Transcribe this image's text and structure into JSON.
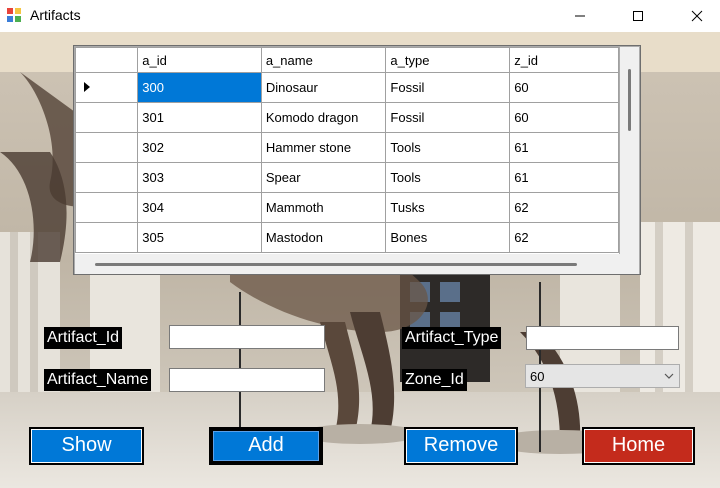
{
  "window": {
    "title": "Artifacts"
  },
  "grid": {
    "columns": [
      "a_id",
      "a_name",
      "a_type",
      "z_id"
    ],
    "rows": [
      [
        "300",
        "Dinosaur",
        "Fossil",
        "60"
      ],
      [
        "301",
        "Komodo dragon",
        "Fossil",
        "60"
      ],
      [
        "302",
        "Hammer stone",
        "Tools",
        "61"
      ],
      [
        "303",
        "Spear",
        "Tools",
        "61"
      ],
      [
        "304",
        "Mammoth",
        "Tusks",
        "62"
      ],
      [
        "305",
        "Mastodon",
        "Bones",
        "62"
      ]
    ],
    "current_row_marker_icon": "triangle-right-icon"
  },
  "form": {
    "artifact_id_label": "Artifact_Id",
    "artifact_id_value": "",
    "artifact_name_label": "Artifact_Name",
    "artifact_name_value": "",
    "artifact_type_label": "Artifact_Type",
    "artifact_type_value": "",
    "zone_id_label": "Zone_Id",
    "zone_id_value": "60"
  },
  "buttons": {
    "show": "Show",
    "add": "Add",
    "remove": "Remove",
    "home": "Home"
  },
  "colors": {
    "selection": "#0078d7",
    "button_blue": "#0078d7",
    "button_red": "#c42b1c"
  }
}
